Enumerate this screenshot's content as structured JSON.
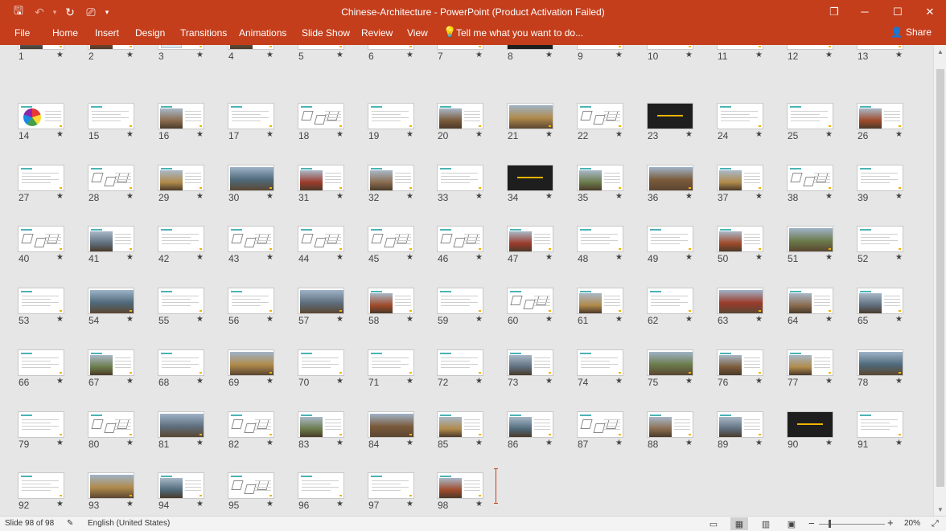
{
  "window": {
    "title": "Chinese-Architecture - PowerPoint (Product Activation Failed)",
    "controls": [
      "❐",
      "─",
      "☐",
      "✕"
    ]
  },
  "qat": {
    "save": "🖫",
    "undo": "↶",
    "undo_arrow": "▾",
    "redo": "↻",
    "present": "⎚",
    "more": "▾"
  },
  "ribbon": {
    "tabs": [
      "File",
      "Home",
      "Insert",
      "Design",
      "Transitions",
      "Animations",
      "Slide Show",
      "Review",
      "View"
    ],
    "tell_me": "Tell me what you want to do...",
    "tell_me_icon": "💡",
    "share": "Share",
    "share_icon": "👤"
  },
  "sorter": {
    "total_slides": 98,
    "selected_slide": 98,
    "star": "★",
    "thumbnail_kinds": {
      "1": "photo",
      "2": "photo",
      "3": "map",
      "4": "photo",
      "8": "dark",
      "11": "diagram",
      "12": "diagram",
      "14": "wheel",
      "16": "photo",
      "18": "diagram",
      "20": "photo",
      "21": "photo",
      "22": "diagram",
      "23": "dark",
      "26": "photo",
      "28": "diagram",
      "29": "photo",
      "30": "photo",
      "31": "photo",
      "32": "photo",
      "34": "dark",
      "35": "photo",
      "36": "photo",
      "37": "photo",
      "38": "diagram",
      "40": "diagram",
      "41": "photo",
      "43": "diagram",
      "44": "diagram",
      "45": "diagram",
      "46": "diagram",
      "47": "photo",
      "50": "photo",
      "51": "photo",
      "54": "photo",
      "57": "photo",
      "58": "photo",
      "60": "diagram",
      "61": "photo",
      "63": "photo",
      "64": "photo",
      "65": "photo",
      "67": "photo",
      "69": "photo",
      "73": "photo",
      "75": "photo",
      "76": "photo",
      "77": "photo",
      "78": "photo",
      "80": "diagram",
      "81": "photo",
      "82": "diagram",
      "83": "photo",
      "84": "photo",
      "85": "photo",
      "86": "photo",
      "87": "diagram",
      "88": "photo",
      "89": "photo",
      "90": "dark",
      "93": "photo",
      "94": "photo",
      "95": "diagram",
      "98": "photo"
    }
  },
  "status": {
    "slide_info": "Slide 98 of 98",
    "language": "English (United States)",
    "zoom": "20%",
    "zoom_minus": "−",
    "zoom_plus": "+",
    "fit_icon": "⤢",
    "notes_icon": "✎",
    "views": [
      "▭",
      "▦",
      "▥",
      "▣"
    ]
  },
  "colors": {
    "accent": "#c43e1c",
    "teal": "#4bb3b5",
    "gold": "#f0b400"
  }
}
